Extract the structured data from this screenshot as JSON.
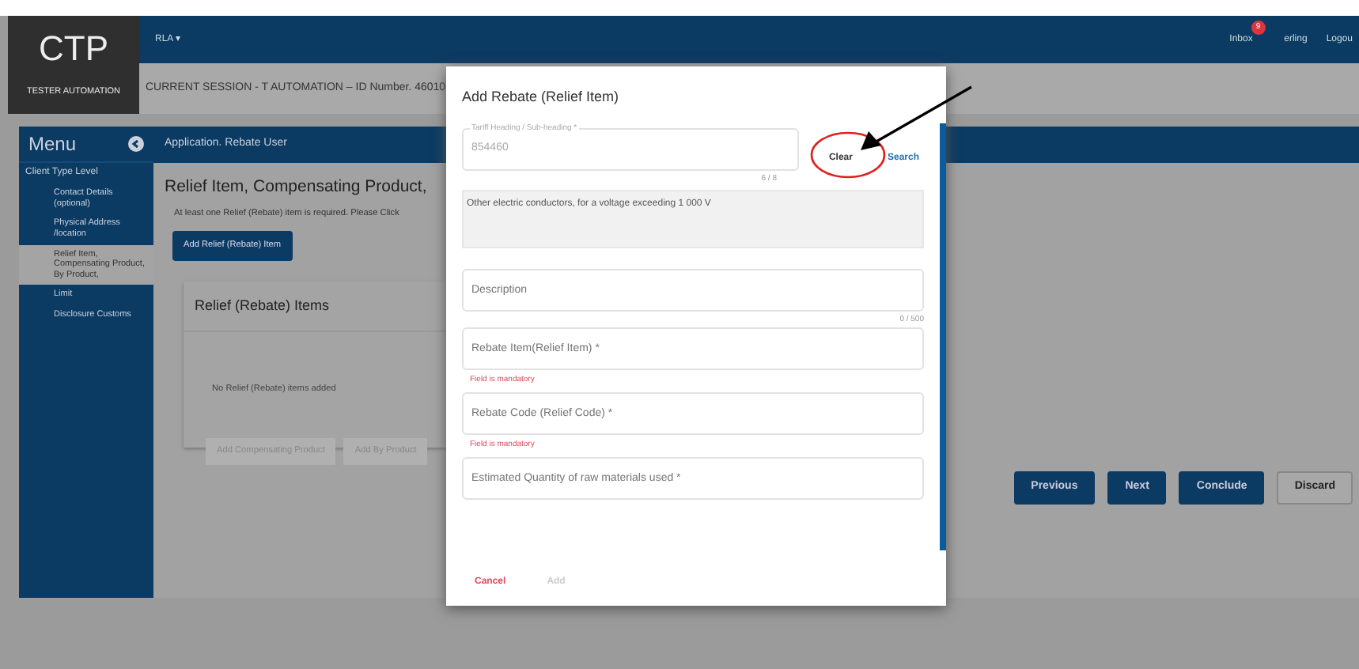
{
  "header": {
    "logo": "CTP",
    "logo_subtitle": "TESTER AUTOMATION",
    "user_menu": "RLA",
    "user_menu_caret": "▾",
    "links": [
      {
        "label": "Inbox",
        "badge": "9"
      },
      {
        "label": "erling"
      },
      {
        "label": "Logou"
      }
    ],
    "session": "CURRENT SESSION - T AUTOMATION – ID Number. 46010"
  },
  "sidebar": {
    "title": "Menu",
    "items": [
      {
        "label": "Client Type Level",
        "selected": false,
        "children": [
          {
            "label": "Contact Details (optional)",
            "selected": false
          },
          {
            "label": "Physical Address /location",
            "selected": false
          },
          {
            "label": "Relief Item, Compensating Product, By Product,",
            "selected": true
          },
          {
            "label": "Limit",
            "selected": false
          },
          {
            "label": "Disclosure Customs",
            "selected": false
          }
        ]
      }
    ]
  },
  "main": {
    "breadcrumb": "Application. Rebate User",
    "title": "Relief Item, Compensating Product,",
    "notice": "At least one Relief (Rebate) item is required. Please Click",
    "add_button": "Add Relief (Rebate) Item",
    "card": {
      "title": "Relief (Rebate) Items",
      "empty_text": "No Relief (Rebate) items added",
      "buttons": [
        {
          "label": "Add Compensating Product",
          "disabled": true
        },
        {
          "label": "Add By Product",
          "disabled": true
        }
      ]
    },
    "nav_buttons": [
      {
        "label": "Previous",
        "kind": "primary"
      },
      {
        "label": "Next",
        "kind": "primary"
      },
      {
        "label": "Conclude",
        "kind": "primary"
      },
      {
        "label": "Discard",
        "kind": "outline"
      }
    ]
  },
  "dialog": {
    "title": "Add Rebate (Relief Item)",
    "fields": [
      {
        "kind": "lookup",
        "label": "Tariff Heading / Sub-heading *",
        "value": "854460",
        "counter": "6 / 8",
        "actions": [
          {
            "label": "Clear",
            "highlighted": true
          },
          {
            "label": "Search",
            "highlighted": false
          }
        ]
      },
      {
        "kind": "readonly",
        "value": "Other electric conductors, for a voltage exceeding 1 000 V"
      },
      {
        "kind": "text",
        "placeholder": "Description",
        "counter": "0 / 500"
      },
      {
        "kind": "text",
        "placeholder": "Rebate Item(Relief Item) *",
        "error": "Field is mandatory"
      },
      {
        "kind": "text",
        "placeholder": "Rebate Code (Relief Code) *",
        "error": "Field is mandatory"
      },
      {
        "kind": "text",
        "placeholder": "Estimated Quantity of raw materials used *"
      }
    ],
    "footer": [
      {
        "label": "Cancel",
        "disabled": false
      },
      {
        "label": "Add",
        "disabled": true
      }
    ]
  }
}
